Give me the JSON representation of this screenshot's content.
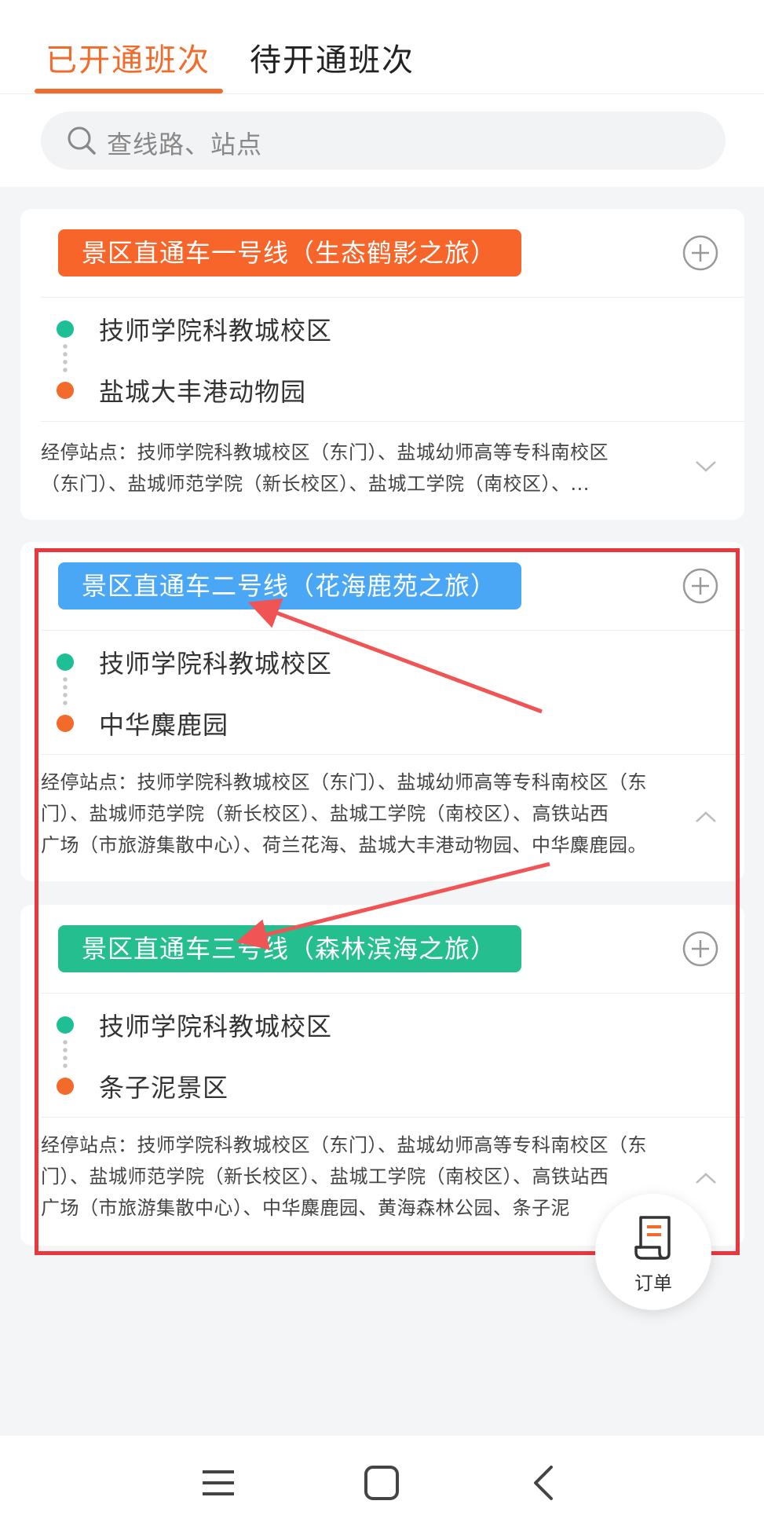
{
  "tabs": {
    "active": "已开通班次",
    "inactive": "待开通班次"
  },
  "search": {
    "placeholder": "查线路、站点"
  },
  "routes": [
    {
      "name": "景区直通车一号线（生态鹤影之旅）",
      "color": "#f7652a",
      "origin": "技师学院科教城校区",
      "destination": "盐城大丰港动物园",
      "via_line1": "经停站点：技师学院科教城校区（东门）、盐城幼师高等专科南校区",
      "via_line2": "（东门）、盐城师范学院（新长校区）、盐城工学院（南校区）、...",
      "expanded": false
    },
    {
      "name": "景区直通车二号线（花海鹿苑之旅）",
      "color": "#4aa7f5",
      "origin": "技师学院科教城校区",
      "destination": "中华麋鹿园",
      "via_line1": "经停站点：技师学院科教城校区（东门）、盐城幼师高等专科南校区（东",
      "via_line2": "门）、盐城师范学院（新长校区）、盐城工学院（南校区）、高铁站西",
      "via_line3": "广场（市旅游集散中心）、荷兰花海、盐城大丰港动物园、中华麋鹿园。",
      "expanded": true
    },
    {
      "name": "景区直通车三号线（森林滨海之旅）",
      "color": "#25bf8f",
      "origin": "技师学院科教城校区",
      "destination": "条子泥景区",
      "via_line1": "经停站点：技师学院科教城校区（东门）、盐城幼师高等专科南校区（东",
      "via_line2": "门）、盐城师范学院（新长校区）、盐城工学院（南校区）、高铁站西",
      "via_line3": "广场（市旅游集散中心）、中华麋鹿园、黄海森林公园、条子泥",
      "expanded": true
    }
  ],
  "order": {
    "label": "订单"
  },
  "colors": {
    "accent": "#f26b2a",
    "origin_dot": "#1fbf95",
    "destination_dot": "#f26b2a",
    "highlight_box": "#e8383d"
  },
  "icons": [
    "search-icon",
    "plus-circle-icon",
    "chevron-down-icon",
    "chevron-up-icon",
    "order-receipt-icon",
    "menu-icon",
    "home-square-icon",
    "back-icon"
  ]
}
